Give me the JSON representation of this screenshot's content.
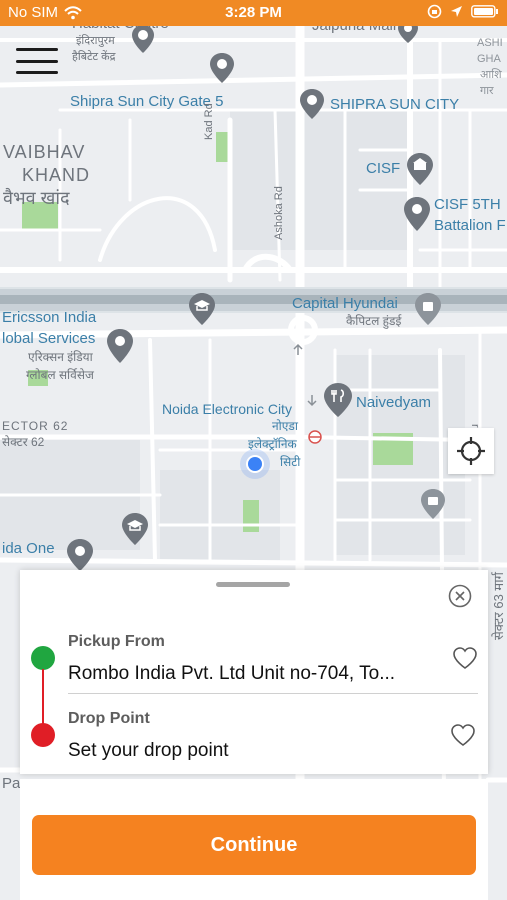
{
  "status_bar": {
    "carrier": "No SIM",
    "time": "3:28 PM"
  },
  "map": {
    "labels": {
      "habitat_centre": "Habitat Centre",
      "habitat_centre_hi1": "इंदिरापुरम",
      "habitat_centre_hi2": "हैबिटेट केंद्र",
      "jaipuria_mall": "Jaipuria Mall",
      "ashi_1": "ASHI",
      "ashi_2": "GHA",
      "ashi_3": "आशि",
      "ashi_4": "गार",
      "shipra_gate": "Shipra Sun City Gate 5",
      "shipra_sun_city": "SHIPRA SUN CITY",
      "vaibhav_1": "VAIBHAV",
      "vaibhav_2": "KHAND",
      "vaibhav_hi": "वैभव खांद",
      "kad_rd": "Kad Rd",
      "ashoka_rd": "Ashoka Rd",
      "cisf": "CISF",
      "cisf_5th_1": "CISF 5TH",
      "cisf_5th_2": "Battalion F",
      "ericsson_1": "Ericsson India",
      "ericsson_2": "lobal Services",
      "ericsson_hi1": "एरिक्सन इंडिया",
      "ericsson_hi2": "ग्लोबल सर्विसेज",
      "capital_hyundai": "Capital Hyundai",
      "capital_hyundai_hi": "कैपिटल हुंडई",
      "sector62": "ECTOR 62",
      "sector62_hi": "सेक्टर 62",
      "naivedyam": "Naivedyam",
      "noida_ec_1": "Noida Electronic City",
      "noida_ec_hi1": "नोएडा",
      "noida_ec_hi2": "इलेक्ट्रॉनिक",
      "noida_ec_hi3": "सिटी",
      "noida_one": "ida One",
      "rd_vertical": "rd",
      "sector_right": "सेक्टर 63 मार्ग",
      "left_pa": "Pa"
    },
    "pin_color": "#6e747c",
    "current_location_color": "#3b82f6"
  },
  "menu_icon": "hamburger-icon",
  "locate_icon": "crosshair-icon",
  "trip_card": {
    "pickup_label": "Pickup From",
    "pickup_value": "Rombo India Pvt. Ltd Unit no-704, To...",
    "drop_label": "Drop Point",
    "drop_value": "Set your drop point",
    "pickup_dot_color": "#20a640",
    "drop_dot_color": "#e01e26"
  },
  "continue_label": "Continue",
  "accent_color": "#f58220"
}
